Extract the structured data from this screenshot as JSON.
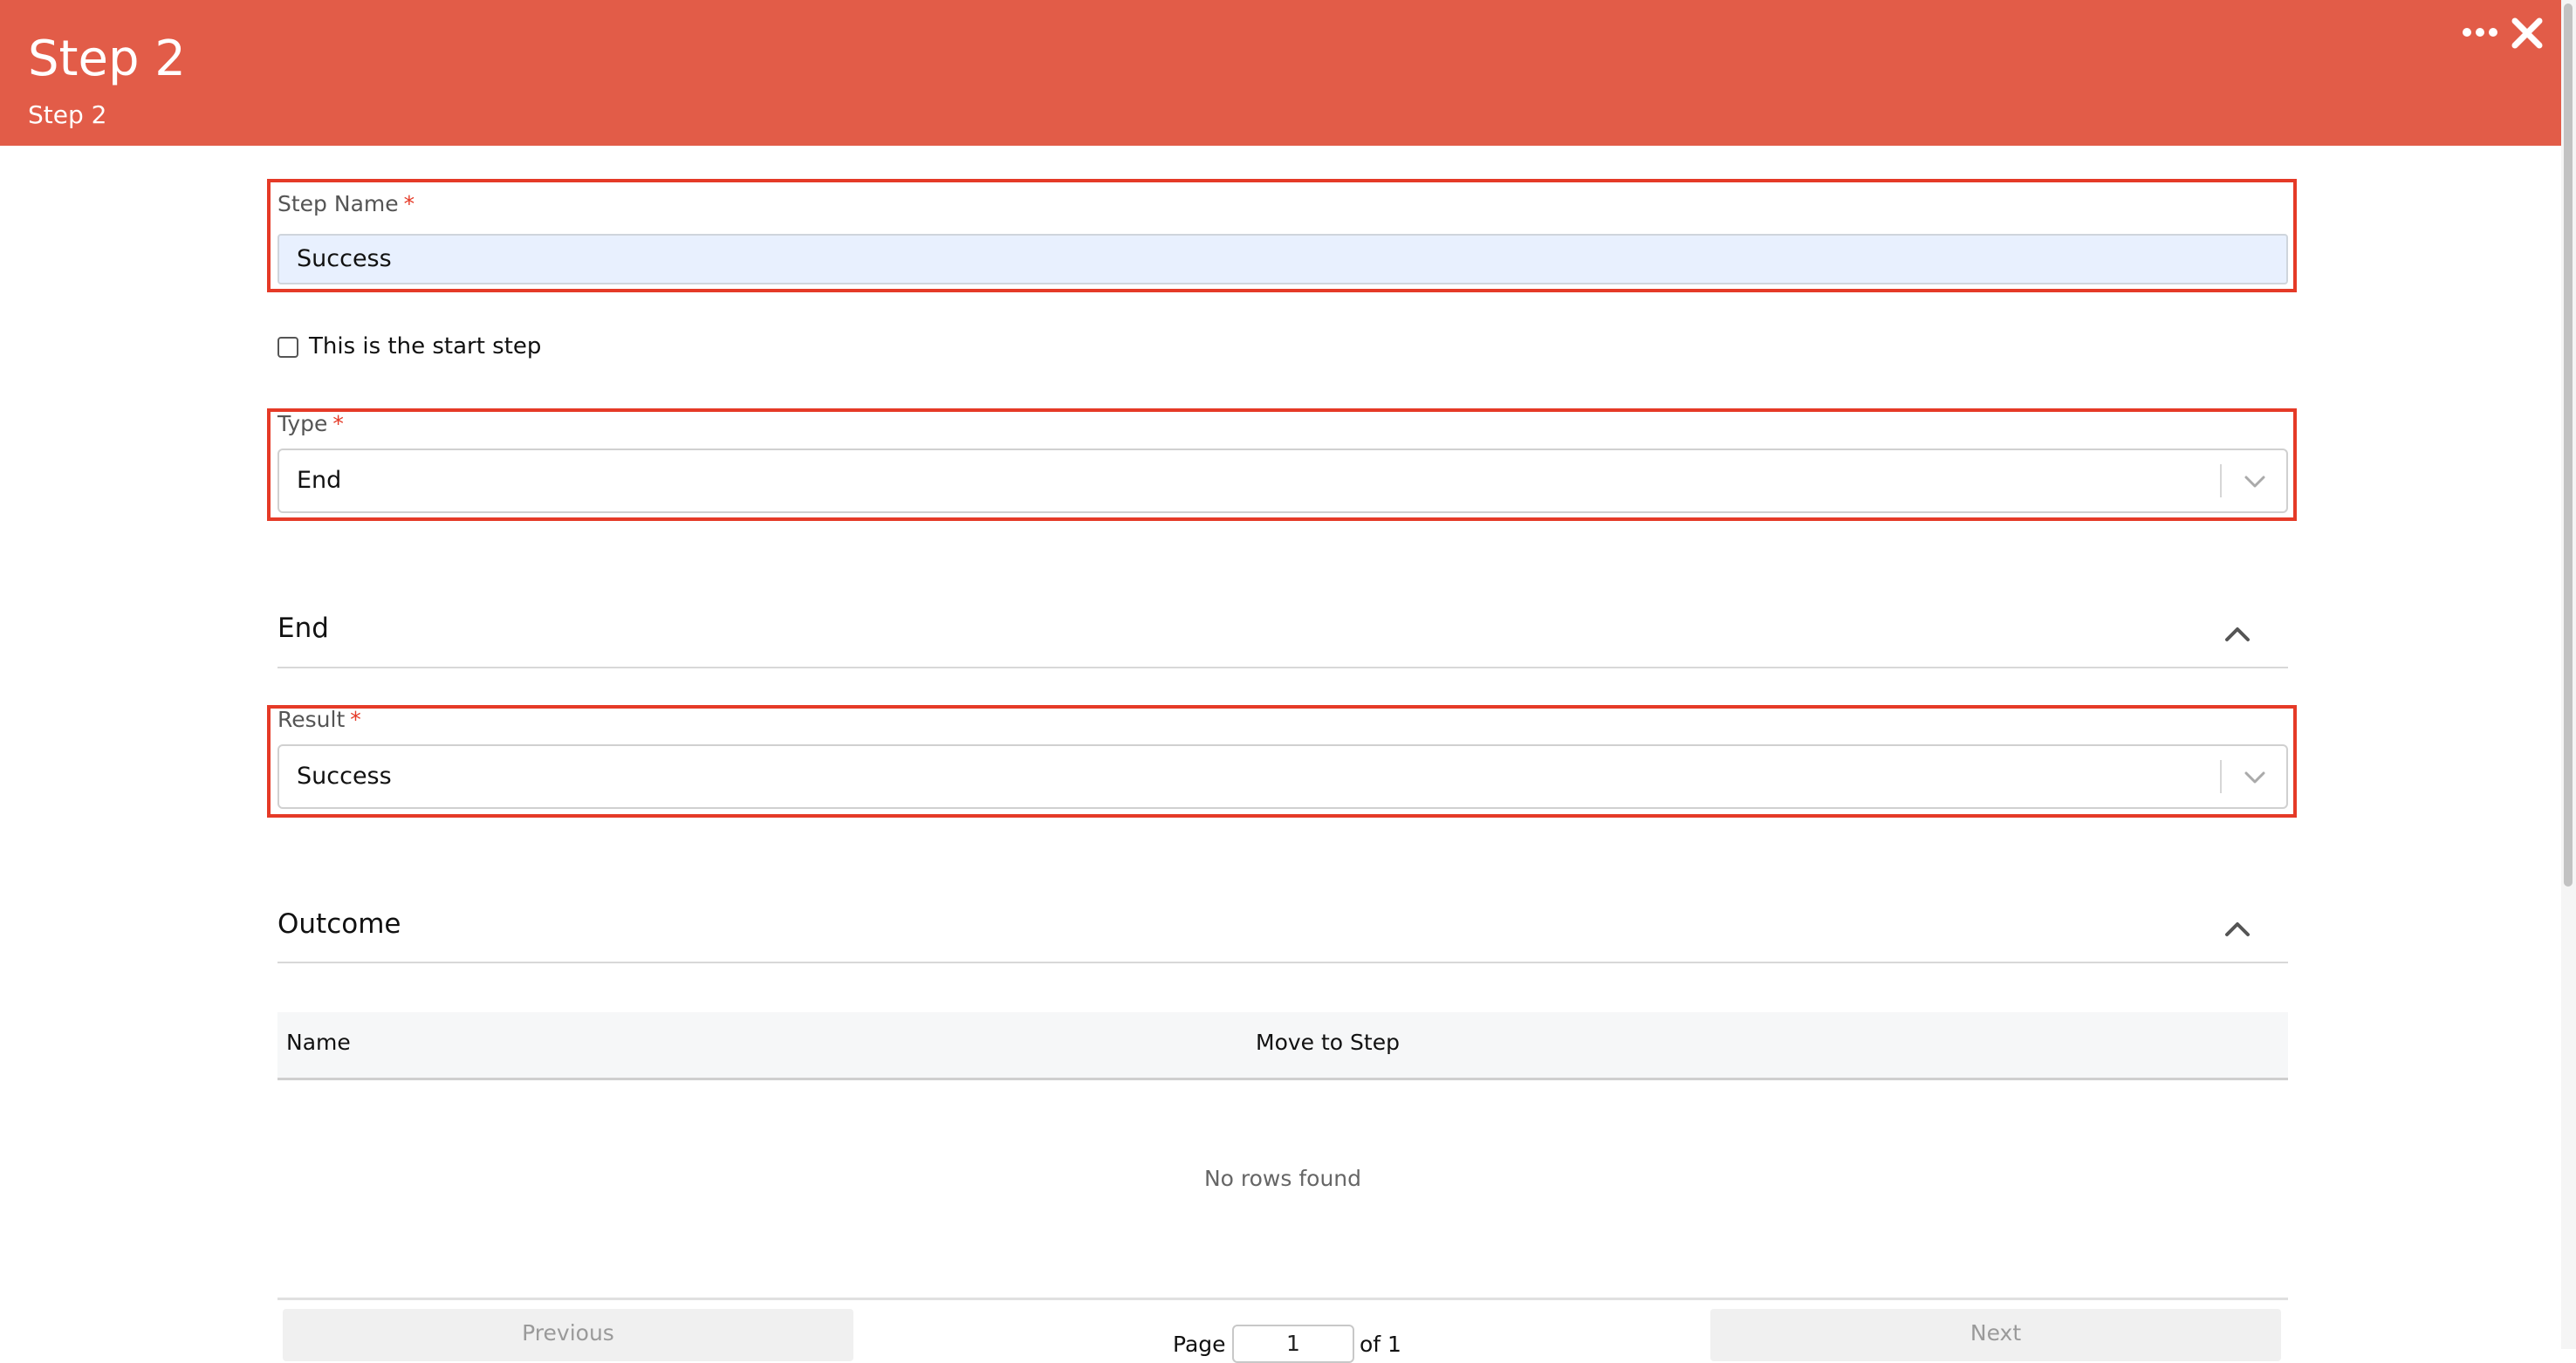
{
  "header": {
    "title": "Step 2",
    "subtitle": "Step 2",
    "more_icon": "more-horizontal-icon",
    "close_icon": "close-icon",
    "color": "#e25c48"
  },
  "form": {
    "step_name": {
      "label": "Step Name",
      "required_mark": "*",
      "value": "Success"
    },
    "start_step": {
      "label": "This is the start step",
      "checked": false
    },
    "type": {
      "label": "Type",
      "required_mark": "*",
      "value": "End"
    }
  },
  "end_section": {
    "title": "End",
    "result": {
      "label": "Result",
      "required_mark": "*",
      "value": "Success"
    }
  },
  "outcome_section": {
    "title": "Outcome",
    "columns": [
      "Name",
      "Move to Step"
    ],
    "empty_message": "No rows found",
    "pagination": {
      "previous": "Previous",
      "next": "Next",
      "page_label": "Page",
      "page_value": "1",
      "of_label": "of 1"
    }
  },
  "colors": {
    "highlight_outline": "#e53a27",
    "required": "#e53a27",
    "autofill_bg": "#e8f0fe"
  }
}
